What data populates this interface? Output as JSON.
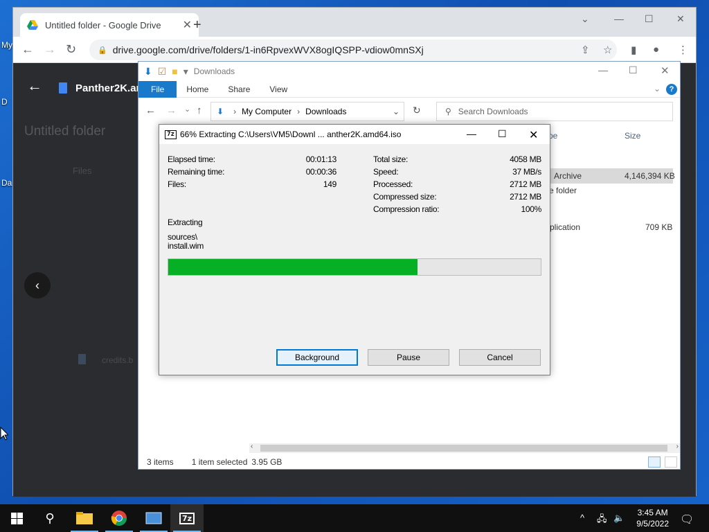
{
  "desktop": {
    "labels": [
      "My",
      "D",
      "Da"
    ]
  },
  "chrome": {
    "tab_title": "Untitled folder - Google Drive",
    "url": "drive.google.com/drive/folders/1-in6RpvexWVX8ogIQSPP-vdiow0mnSXj",
    "drive": {
      "file_title": "Panther2K.am",
      "folder_title": "Untitled folder",
      "files_label": "Files",
      "credits_file": "credits.b"
    }
  },
  "explorer": {
    "title": "Downloads",
    "ribbon_tabs": [
      "File",
      "Home",
      "Share",
      "View"
    ],
    "address": [
      "My Computer",
      "Downloads"
    ],
    "search_placeholder": "Search Downloads",
    "columns": {
      "type": "pe",
      "size": "Size"
    },
    "rows": [
      {
        "type": "Archive",
        "size": "4,146,394 KB"
      },
      {
        "type": "e folder",
        "size": ""
      },
      {
        "type": "plication",
        "size": "709 KB"
      }
    ],
    "status": {
      "items": "3 items",
      "selected": "1 item selected",
      "size": "3.95 GB"
    }
  },
  "sevenzip": {
    "title": "66% Extracting C:\\Users\\VM5\\Downl ... anther2K.amd64.iso",
    "progress_fraction": 0.67,
    "left_stats": [
      {
        "label": "Elapsed time:",
        "value": "00:01:13"
      },
      {
        "label": "Remaining time:",
        "value": "00:00:36"
      },
      {
        "label": "Files:",
        "value": "149"
      }
    ],
    "right_stats": [
      {
        "label": "Total size:",
        "value": "4058 MB"
      },
      {
        "label": "Speed:",
        "value": "37 MB/s"
      },
      {
        "label": "Processed:",
        "value": "2712 MB"
      },
      {
        "label": "Compressed size:",
        "value": "2712 MB"
      },
      {
        "label": "Compression ratio:",
        "value": "100%"
      }
    ],
    "action": "Extracting",
    "path_line1": "sources\\",
    "path_line2": "install.wim",
    "buttons": {
      "background": "Background",
      "pause": "Pause",
      "cancel": "Cancel"
    }
  },
  "taskbar": {
    "clock_time": "3:45 AM",
    "clock_date": "9/5/2022",
    "sevenzip_label": "7z"
  },
  "colors": {
    "progress": "#06b025",
    "accent": "#1979ca"
  }
}
